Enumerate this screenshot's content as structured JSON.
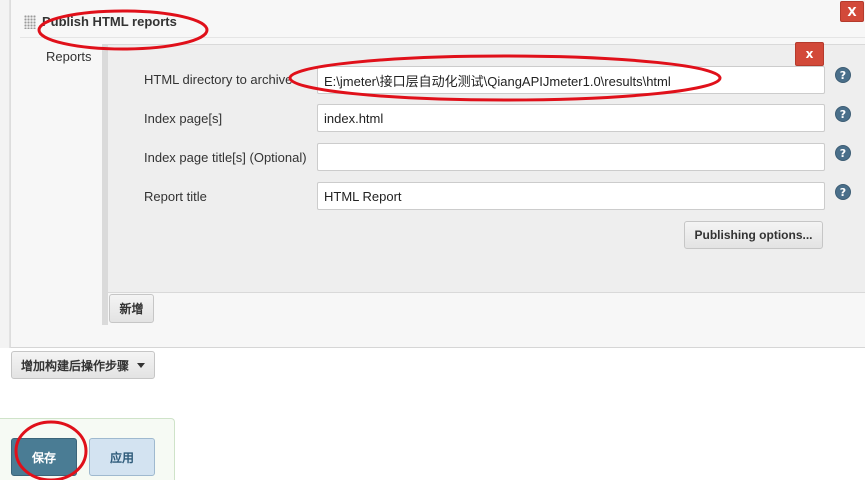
{
  "section": {
    "title": "Publish HTML reports",
    "close_label": "X"
  },
  "reports": {
    "label": "Reports",
    "remove_label": "x",
    "fields": [
      {
        "label": "HTML directory to archive",
        "value": "E:\\jmeter\\接口层自动化测试\\QiangAPIJmeter1.0\\results\\html"
      },
      {
        "label": "Index page[s]",
        "value": "index.html"
      },
      {
        "label": "Index page title[s] (Optional)",
        "value": ""
      },
      {
        "label": "Report title",
        "value": "HTML Report"
      }
    ],
    "help_glyph": "?",
    "publishing_options_label": "Publishing options...",
    "add_label": "新增"
  },
  "post_build": {
    "add_step_label": "增加构建后操作步骤"
  },
  "footer": {
    "save_label": "保存",
    "apply_label": "应用"
  },
  "colors": {
    "annotation": "#e0101a",
    "close": "#d24939",
    "save": "#4a7c94",
    "apply": "#d3e3f1"
  },
  "icons": {
    "drag": "drag-handle-icon",
    "help": "help-icon",
    "dropdown": "caret-down-icon"
  }
}
